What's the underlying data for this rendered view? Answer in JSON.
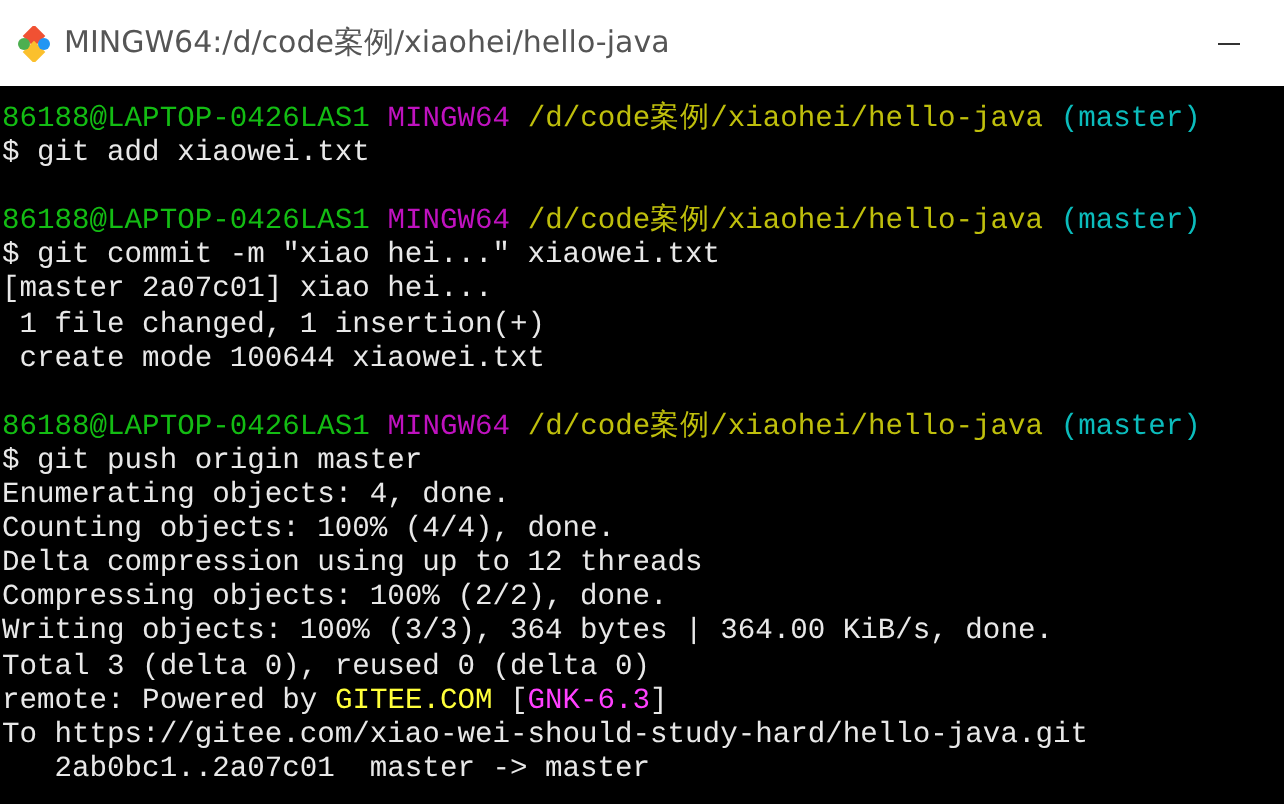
{
  "window": {
    "title": "MINGW64:/d/code案例/xiaohei/hello-java"
  },
  "terminal": {
    "lines": [
      {
        "segments": [
          {
            "kind": "user",
            "text": "86188@LAPTOP-0426LAS1"
          },
          {
            "kind": "shell",
            "text": "MINGW64"
          },
          {
            "kind": "path",
            "text": "/d/code案例/xiaohei/hello-java"
          },
          {
            "kind": "branch",
            "text": "(master)"
          }
        ]
      },
      {
        "segments": [
          {
            "kind": "plain",
            "text": "$ git add xiaowei.txt"
          }
        ]
      },
      {
        "blank_before": true,
        "segments": [
          {
            "kind": "user",
            "text": "86188@LAPTOP-0426LAS1"
          },
          {
            "kind": "shell",
            "text": "MINGW64"
          },
          {
            "kind": "path",
            "text": "/d/code案例/xiaohei/hello-java"
          },
          {
            "kind": "branch",
            "text": "(master)"
          }
        ]
      },
      {
        "segments": [
          {
            "kind": "plain",
            "text": "$ git commit -m \"xiao hei...\" xiaowei.txt"
          }
        ]
      },
      {
        "segments": [
          {
            "kind": "plain",
            "text": "[master 2a07c01] xiao hei..."
          }
        ]
      },
      {
        "segments": [
          {
            "kind": "plain",
            "text": " 1 file changed, 1 insertion(+)"
          }
        ]
      },
      {
        "segments": [
          {
            "kind": "plain",
            "text": " create mode 100644 xiaowei.txt"
          }
        ]
      },
      {
        "blank_before": true,
        "segments": [
          {
            "kind": "user",
            "text": "86188@LAPTOP-0426LAS1"
          },
          {
            "kind": "shell",
            "text": "MINGW64"
          },
          {
            "kind": "path",
            "text": "/d/code案例/xiaohei/hello-java"
          },
          {
            "kind": "branch",
            "text": "(master)"
          }
        ]
      },
      {
        "segments": [
          {
            "kind": "plain",
            "text": "$ git push origin master"
          }
        ]
      },
      {
        "segments": [
          {
            "kind": "plain",
            "text": "Enumerating objects: 4, done."
          }
        ]
      },
      {
        "segments": [
          {
            "kind": "plain",
            "text": "Counting objects: 100% (4/4), done."
          }
        ]
      },
      {
        "segments": [
          {
            "kind": "plain",
            "text": "Delta compression using up to 12 threads"
          }
        ]
      },
      {
        "segments": [
          {
            "kind": "plain",
            "text": "Compressing objects: 100% (2/2), done."
          }
        ]
      },
      {
        "segments": [
          {
            "kind": "plain",
            "text": "Writing objects: 100% (3/3), 364 bytes | 364.00 KiB/s, done."
          }
        ]
      },
      {
        "segments": [
          {
            "kind": "plain",
            "text": "Total 3 (delta 0), reused 0 (delta 0)"
          }
        ]
      },
      {
        "segments": [
          {
            "kind": "plain",
            "text": "remote: Powered by"
          },
          {
            "kind": "highlight",
            "text": "GITEE.COM"
          },
          {
            "kind": "plain",
            "text": "["
          },
          {
            "kind": "tag",
            "text": "GNK-6.3"
          },
          {
            "kind": "plain",
            "text": "]"
          }
        ]
      },
      {
        "segments": [
          {
            "kind": "plain",
            "text": "To https://gitee.com/xiao-wei-should-study-hard/hello-java.git"
          }
        ]
      },
      {
        "segments": [
          {
            "kind": "plain",
            "text": "   2ab0bc1..2a07c01  master -> master"
          }
        ]
      }
    ]
  }
}
